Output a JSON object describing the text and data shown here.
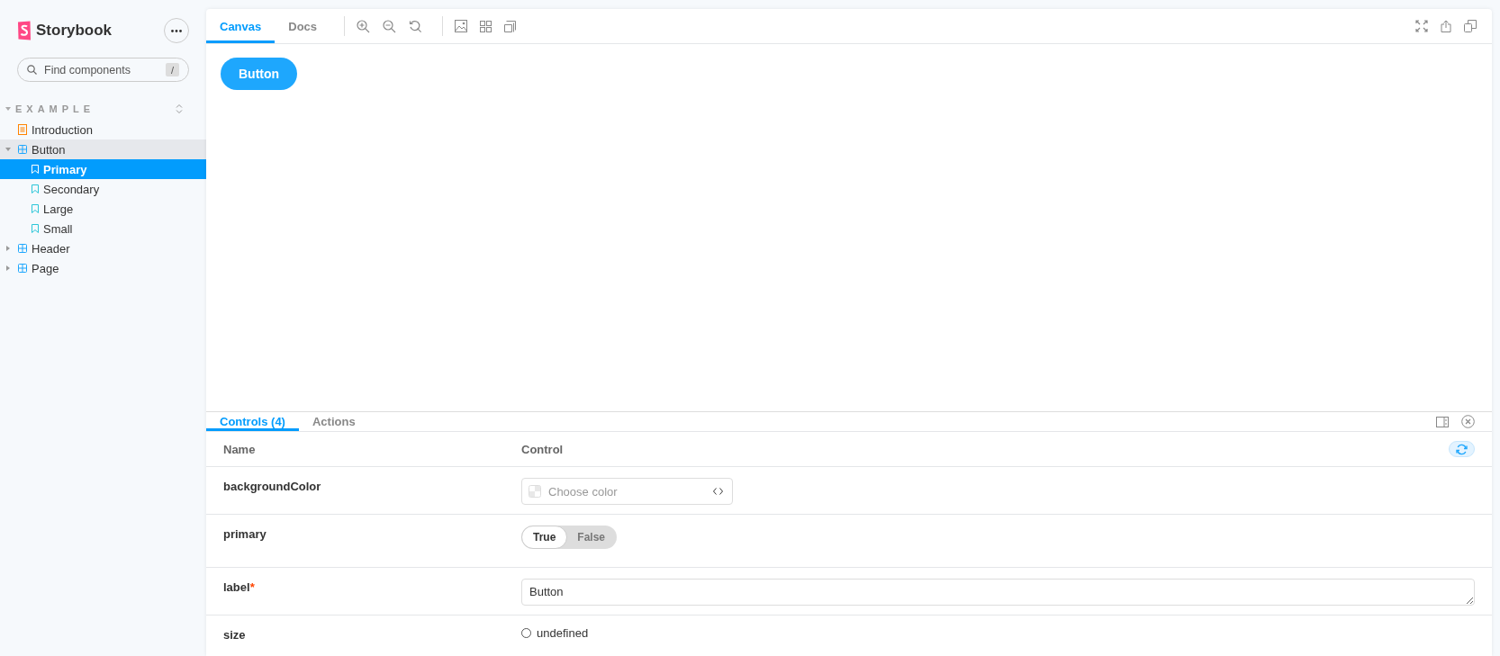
{
  "sidebar": {
    "brand": "Storybook",
    "search": {
      "placeholder": "Find components",
      "shortcut": "/"
    },
    "group": {
      "label": "EXAMPLE",
      "expanded": true,
      "items": [
        {
          "label": "Introduction",
          "kind": "doc",
          "selected": false
        },
        {
          "label": "Button",
          "kind": "component",
          "selected": false,
          "expanded": true,
          "children": [
            {
              "label": "Primary",
              "kind": "story",
              "selected": true
            },
            {
              "label": "Secondary",
              "kind": "story",
              "selected": false
            },
            {
              "label": "Large",
              "kind": "story",
              "selected": false
            },
            {
              "label": "Small",
              "kind": "story",
              "selected": false
            }
          ]
        },
        {
          "label": "Header",
          "kind": "component",
          "selected": false,
          "expanded": false
        },
        {
          "label": "Page",
          "kind": "component",
          "selected": false,
          "expanded": false
        }
      ]
    }
  },
  "toolbar": {
    "tabs": [
      {
        "label": "Canvas",
        "selected": true
      },
      {
        "label": "Docs",
        "selected": false
      }
    ]
  },
  "canvas": {
    "button_label": "Button"
  },
  "addons": {
    "tabs": [
      {
        "label": "Controls (4)",
        "selected": true
      },
      {
        "label": "Actions",
        "selected": false
      }
    ],
    "columns": [
      "Name",
      "Control"
    ],
    "rows": [
      {
        "name": "backgroundColor",
        "kind": "color",
        "placeholder": "Choose color"
      },
      {
        "name": "primary",
        "kind": "boolean",
        "options": [
          {
            "label": "True",
            "selected": true
          },
          {
            "label": "False",
            "selected": false
          }
        ]
      },
      {
        "name": "label",
        "kind": "text",
        "required_mark": "*",
        "value": "Button"
      },
      {
        "name": "size",
        "kind": "radio",
        "options": [
          {
            "label": "undefined",
            "selected": false
          }
        ]
      }
    ]
  }
}
